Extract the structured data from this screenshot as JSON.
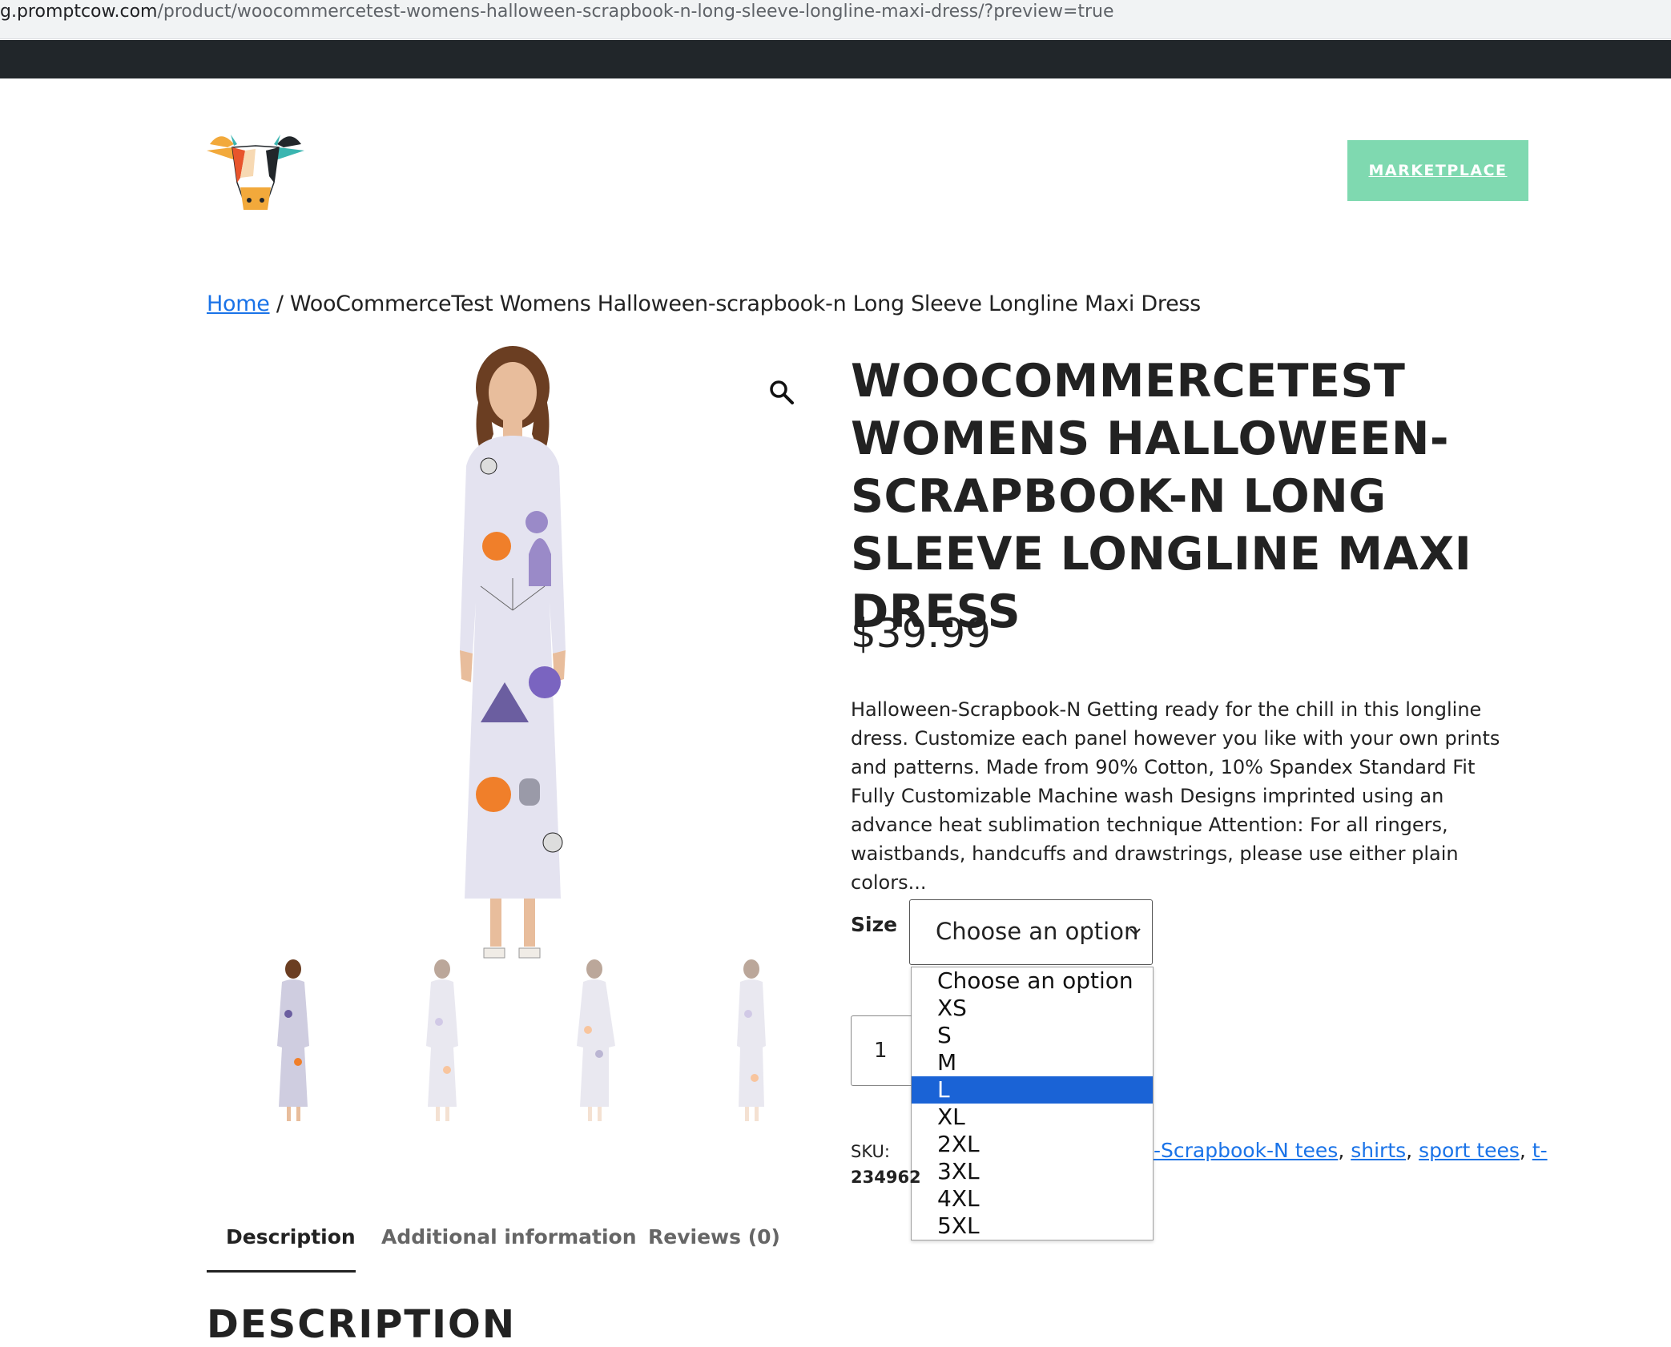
{
  "browser": {
    "url_host": "g.promptcow.com",
    "url_path": "/product/woocommercetest-womens-halloween-scrapbook-n-long-sleeve-longline-maxi-dress/?preview=true"
  },
  "header": {
    "marketplace_label": "MARKETPLACE"
  },
  "breadcrumb": {
    "home": "Home",
    "separator": " / ",
    "current": "WooCommerceTest Womens Halloween-scrapbook-n Long Sleeve Longline Maxi Dress"
  },
  "product": {
    "title": "WOOCOMMERCETEST WOMENS HALLOWEEN-SCRAPBOOK-N LONG SLEEVE LONGLINE MAXI DRESS",
    "price": "$39.99",
    "description": "Halloween-Scrapbook-N Getting ready for the chill in this longline dress. Customize each panel however you like with your own prints and patterns. Made from 90% Cotton, 10% Spandex Standard Fit Fully Customizable Machine wash Designs imprinted using an advance heat sublimation technique Attention: For all ringers, waistbands, handcuffs and drawstrings, please use either plain colors...",
    "size_label": "Size",
    "size_selected": "Choose an option",
    "size_options": [
      "Choose an option",
      "XS",
      "S",
      "M",
      "L",
      "XL",
      "2XL",
      "3XL",
      "4XL",
      "5XL"
    ],
    "size_highlighted": "L",
    "quantity": "1",
    "sku_label": "SKU:",
    "sku_value": "234962",
    "tags": [
      "-Scrapbook-N tees",
      "shirts",
      "sport tees",
      "t-"
    ]
  },
  "tabs": [
    "Description",
    "Additional information",
    "Reviews (0)"
  ],
  "section_heading": "DESCRIPTION",
  "colors": {
    "top_bar": "#21262a",
    "marketplace_button": "#7fd9b0",
    "link": "#1a73e8",
    "dropdown_highlight": "#1a63d6"
  },
  "icons": [
    "cow-logo-icon",
    "magnifier-icon",
    "chevron-down-icon"
  ]
}
